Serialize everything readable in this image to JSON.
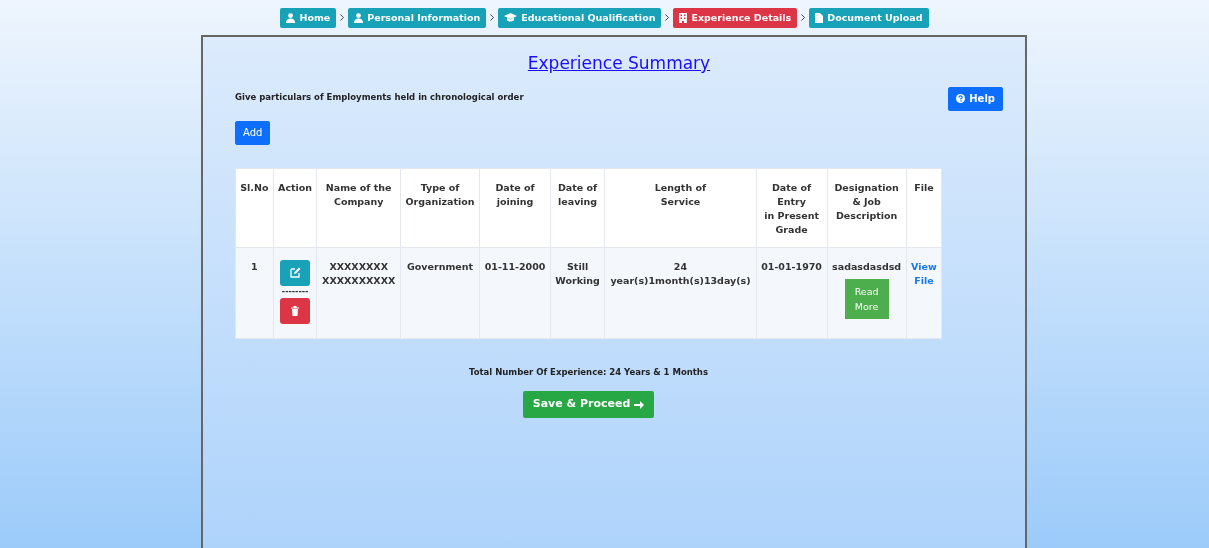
{
  "steps": [
    {
      "label": "Home",
      "selected": false
    },
    {
      "label": "Personal Information",
      "selected": false
    },
    {
      "label": "Educational Qualification",
      "selected": false
    },
    {
      "label": "Experience Details",
      "selected": true
    },
    {
      "label": "Document Upload",
      "selected": false
    }
  ],
  "title": "Experience Summary",
  "instruction": "Give particulars of Employments held in chronological order",
  "help_button": "Help",
  "add_button": "Add",
  "table": {
    "columns": [
      "Sl.No",
      "Action",
      "Name of the\nCompany",
      "Type of\nOrganization",
      "Date of\njoining",
      "Date of\nleaving",
      "Length of\nService",
      "Date of\nEntry\nin Present\nGrade",
      "Designation\n& Job\nDescription",
      "File"
    ],
    "rows": [
      {
        "sl_no": "1",
        "action_separator": "--------",
        "company": "XXXXXXXX\nXXXXXXXXXX",
        "organization": "Government",
        "joining": "01-11-2000",
        "leaving": "Still\nWorking",
        "service": "24\nyear(s)1month(s)13day(s)",
        "entry_date": "01-01-1970",
        "designation": "sadasdasdsd",
        "read_more": "Read\nMore",
        "file_link": "View\nFile"
      }
    ]
  },
  "total": "Total Number Of Experience: 24 Years & 1 Months",
  "save_button": "Save & Proceed"
}
